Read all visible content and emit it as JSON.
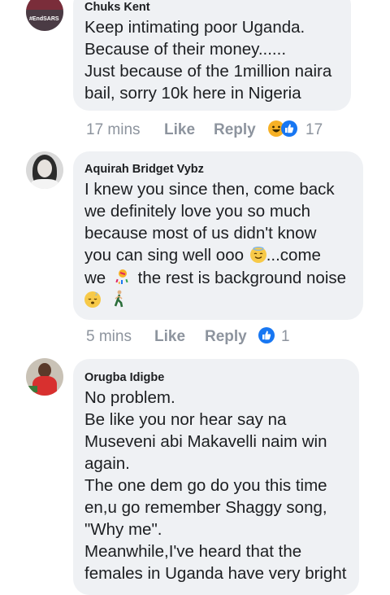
{
  "comments": [
    {
      "author": "Chuks Kent",
      "avatar_text": "#EndSARS",
      "lines": [
        " Keep intimating poor Uganda.",
        "Because of their money......",
        "Just because of the 1million naira",
        "bail,  sorry 10k here in Nigeria"
      ],
      "time": "17 mins",
      "like_label": "Like",
      "reply_label": "Reply",
      "reactions": [
        "haha-icon",
        "like-icon"
      ],
      "reaction_count": "17"
    },
    {
      "author": "Aquirah Bridget Vybz",
      "lines": [
        "I knew you since then, come back",
        "we definitely love you so much",
        "because most of us didn't know",
        "you can sing well ooo",
        "...come",
        "we",
        "the rest is background noise"
      ],
      "time": "5 mins",
      "like_label": "Like",
      "reply_label": "Reply",
      "reactions": [
        "like-icon"
      ],
      "reaction_count": "1"
    },
    {
      "author": "Orugba Idigbe",
      "lines": [
        "No problem.",
        "Be like you nor hear say na",
        "Museveni abi Makavelli naim win",
        "again.",
        "The one dem go do you this time",
        "en,u go remember Shaggy song,",
        "\"Why me\".",
        "Meanwhile,I've heard that the",
        "females in Uganda have very bright"
      ]
    }
  ],
  "colors": {
    "bubble": "#eff1f4",
    "text": "#1c1e21",
    "meta": "#8d949e",
    "like_blue": "#1877f2",
    "haha_yellow": "#f7b125"
  }
}
